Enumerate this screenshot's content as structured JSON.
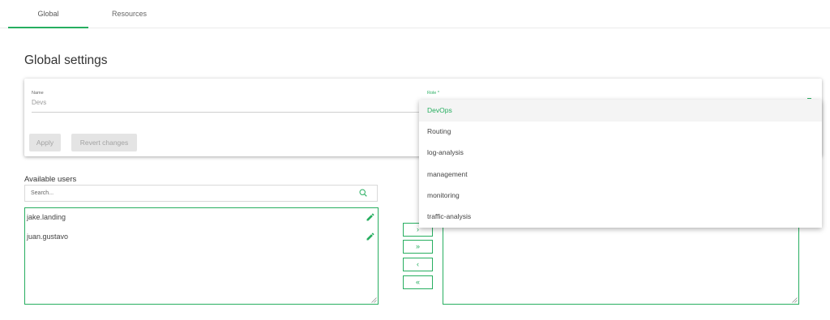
{
  "tabs": [
    {
      "label": "Global",
      "active": true
    },
    {
      "label": "Resources",
      "active": false
    }
  ],
  "page_title": "Global settings",
  "form": {
    "name_label": "Name",
    "name_value": "Devs",
    "role_label": "Role *",
    "apply_label": "Apply",
    "revert_label": "Revert changes"
  },
  "available_users": {
    "label": "Available users",
    "search_placeholder": "Search...",
    "items": [
      "jake.landing",
      "juan.gustavo"
    ]
  },
  "transfer": {
    "add": "›",
    "add_all": "»",
    "remove": "‹",
    "remove_all": "«"
  },
  "role_dropdown": {
    "selected": "DevOps",
    "options": [
      "DevOps",
      "Routing",
      "log-analysis",
      "management",
      "monitoring",
      "traffic-analysis"
    ]
  },
  "colors": {
    "accent": "#27ae60",
    "disabled_button": "#e4e4e4"
  },
  "icons": [
    "search-icon",
    "edit-icon",
    "resize-handle-icon"
  ]
}
